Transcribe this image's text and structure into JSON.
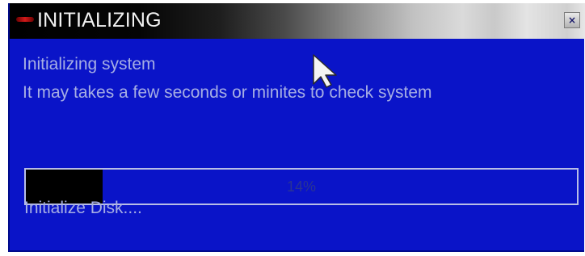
{
  "window": {
    "title": "INITIALIZING",
    "close_label": "×"
  },
  "messages": {
    "line1": "Initializing system",
    "line2": "It may takes a few seconds or minites to check system"
  },
  "progress": {
    "percent": 14,
    "label": "14%"
  },
  "status": {
    "text": "Initialize Disk...."
  },
  "colors": {
    "dialog_background": "#0a14c8",
    "text": "#a6aee4",
    "progress_fill": "#000000"
  },
  "icons": {
    "title_icon": "red-bar-icon",
    "cursor": "mouse-pointer-icon"
  }
}
